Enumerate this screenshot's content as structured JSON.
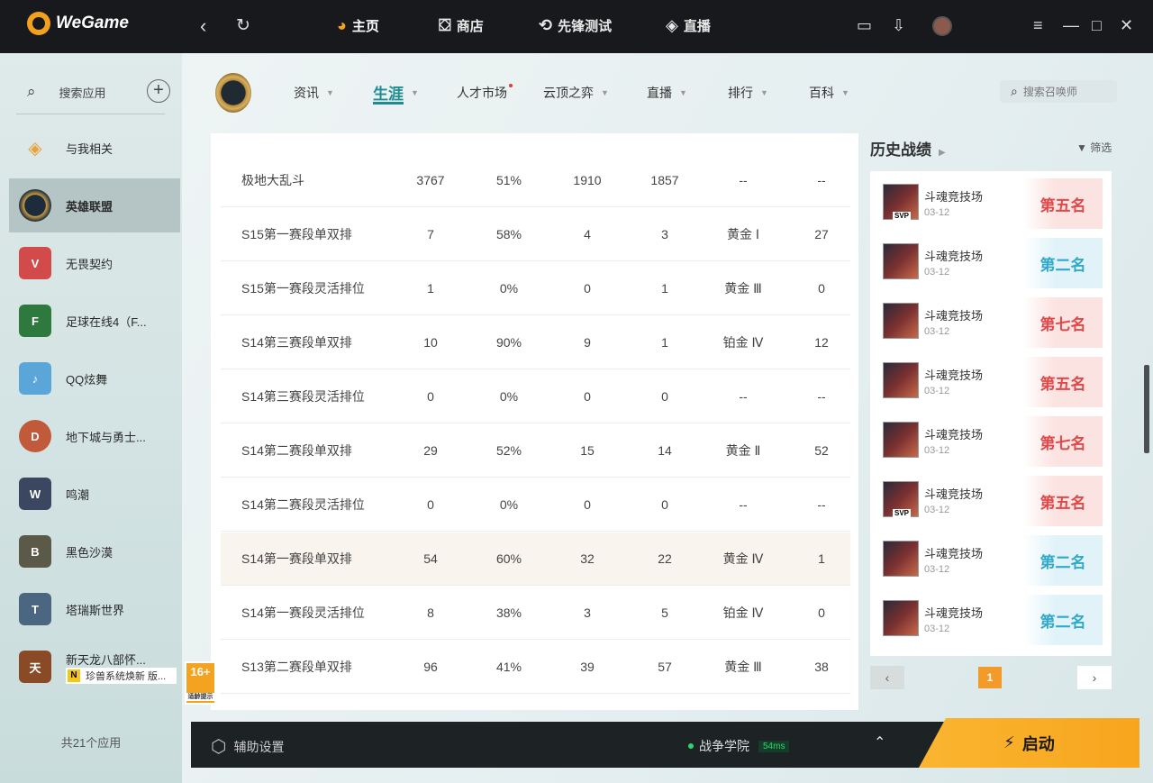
{
  "topbar": {
    "brand": "WeGame",
    "nav": [
      {
        "label": "主页",
        "icon": "pacman-icon"
      },
      {
        "label": "商店",
        "icon": "shopping-bag-icon"
      },
      {
        "label": "先锋测试",
        "icon": "lightning-circle-icon"
      },
      {
        "label": "直播",
        "icon": "play-diamond-icon"
      }
    ]
  },
  "sidebar": {
    "search_label": "搜索应用",
    "items": [
      {
        "label": "与我相关",
        "color": "#e8a23a"
      },
      {
        "label": "英雄联盟",
        "color": "#1d2c3a"
      },
      {
        "label": "无畏契约",
        "color": "#d34a4a"
      },
      {
        "label": "足球在线4（F...",
        "color": "#2e7a3e"
      },
      {
        "label": "QQ炫舞",
        "color": "#5aa6d8"
      },
      {
        "label": "地下城与勇士...",
        "color": "#c05a3a"
      },
      {
        "label": "鸣潮",
        "color": "#3b4660"
      },
      {
        "label": "黑色沙漠",
        "color": "#5b5a48"
      },
      {
        "label": "塔瑞斯世界",
        "color": "#4a6680"
      },
      {
        "label": "新天龙八部怀...",
        "color": "#8a4a26"
      }
    ],
    "sub_badge": {
      "letter": "N",
      "text": "珍兽系统焕新 版..."
    },
    "footer": "共21个应用",
    "age_badge": {
      "rating": "16+",
      "note": "适龄提示"
    }
  },
  "subnav": {
    "items": [
      {
        "label": "资讯"
      },
      {
        "label": "生涯"
      },
      {
        "label": "人才市场"
      },
      {
        "label": "云顶之弈"
      },
      {
        "label": "直播"
      },
      {
        "label": "排行"
      },
      {
        "label": "百科"
      }
    ],
    "search_placeholder": "搜索召唤师"
  },
  "career_table": {
    "rows": [
      [
        "极地大乱斗",
        "3767",
        "51%",
        "1910",
        "1857",
        "--",
        "--"
      ],
      [
        "S15第一赛段单双排",
        "7",
        "58%",
        "4",
        "3",
        "黄金 Ⅰ",
        "27"
      ],
      [
        "S15第一赛段灵活排位",
        "1",
        "0%",
        "0",
        "1",
        "黄金 Ⅲ",
        "0"
      ],
      [
        "S14第三赛段单双排",
        "10",
        "90%",
        "9",
        "1",
        "铂金 Ⅳ",
        "12"
      ],
      [
        "S14第三赛段灵活排位",
        "0",
        "0%",
        "0",
        "0",
        "--",
        "--"
      ],
      [
        "S14第二赛段单双排",
        "29",
        "52%",
        "15",
        "14",
        "黄金 Ⅱ",
        "52"
      ],
      [
        "S14第二赛段灵活排位",
        "0",
        "0%",
        "0",
        "0",
        "--",
        "--"
      ],
      [
        "S14第一赛段单双排",
        "54",
        "60%",
        "32",
        "22",
        "黄金 Ⅳ",
        "1"
      ],
      [
        "S14第一赛段灵活排位",
        "8",
        "38%",
        "3",
        "5",
        "铂金 Ⅳ",
        "0"
      ],
      [
        "S13第二赛段单双排",
        "96",
        "41%",
        "39",
        "57",
        "黄金 Ⅲ",
        "38"
      ]
    ]
  },
  "history": {
    "title": "历史战绩",
    "filter": "筛选",
    "items": [
      {
        "mode": "斗魂竞技场",
        "date": "03-12",
        "rank": "第五名",
        "tone": "red",
        "svp": true
      },
      {
        "mode": "斗魂竞技场",
        "date": "03-12",
        "rank": "第二名",
        "tone": "blue",
        "svp": false
      },
      {
        "mode": "斗魂竞技场",
        "date": "03-12",
        "rank": "第七名",
        "tone": "red",
        "svp": false
      },
      {
        "mode": "斗魂竞技场",
        "date": "03-12",
        "rank": "第五名",
        "tone": "red",
        "svp": false
      },
      {
        "mode": "斗魂竞技场",
        "date": "03-12",
        "rank": "第七名",
        "tone": "red",
        "svp": false
      },
      {
        "mode": "斗魂竞技场",
        "date": "03-12",
        "rank": "第五名",
        "tone": "red",
        "svp": true
      },
      {
        "mode": "斗魂竞技场",
        "date": "03-12",
        "rank": "第二名",
        "tone": "blue",
        "svp": false
      },
      {
        "mode": "斗魂竞技场",
        "date": "03-12",
        "rank": "第二名",
        "tone": "blue",
        "svp": false
      }
    ],
    "page": "1"
  },
  "bottombar": {
    "assist": "辅助设置",
    "server": "战争学院",
    "ping": "54ms",
    "launch": "启动"
  }
}
